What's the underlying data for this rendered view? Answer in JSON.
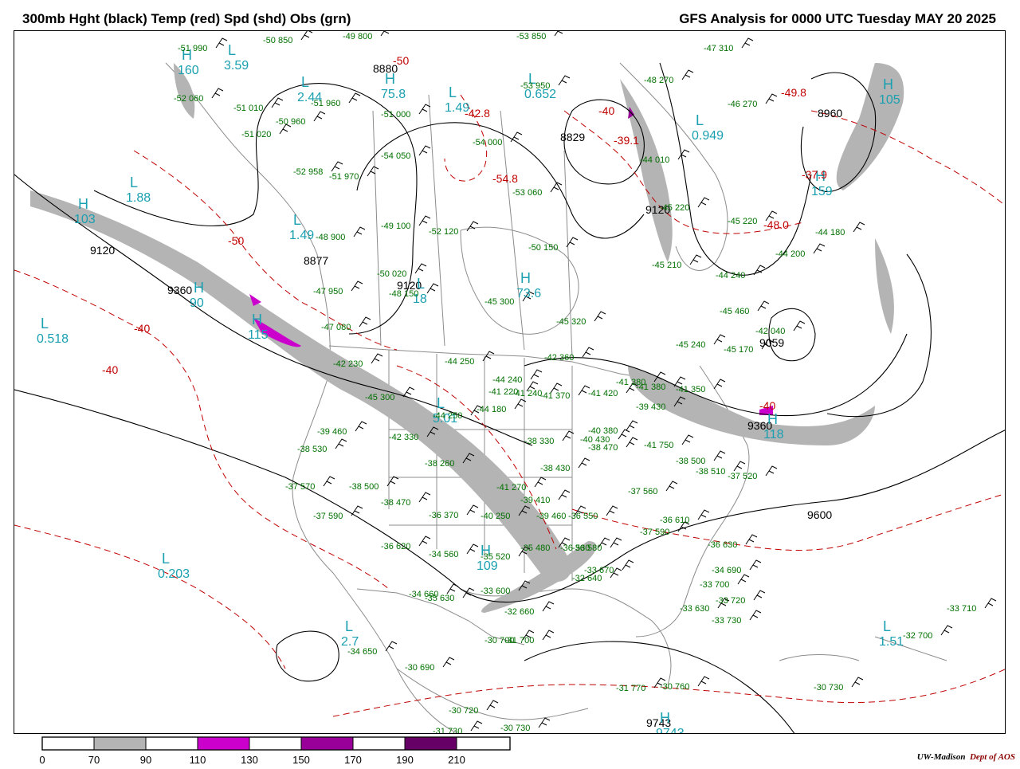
{
  "header": {
    "left_title": "300mb Hght (black) Temp (red) Spd (shd) Obs (grn)",
    "right_title": "GFS Analysis for 0000 UTC Tuesday  MAY 20 2025"
  },
  "colors": {
    "height_contour": "#000000",
    "temp_contour": "#c00000",
    "speed_shading_70_90": "#b4b4b4",
    "speed_shading_110_130": "#cc00cc",
    "speed_shading_150_170": "#990099",
    "speed_shading_190_210": "#660066",
    "obs_text": "#007000",
    "speed_label": "#1aa0b0",
    "geography": "#888888"
  },
  "legend": {
    "ticks": [
      "0",
      "70",
      "90",
      "110",
      "130",
      "150",
      "170",
      "190",
      "210"
    ]
  },
  "credit": {
    "org": "UW-Madison",
    "dept": "Dept of AOS"
  },
  "height_labels": [
    {
      "text": "9360"
    },
    {
      "text": "9120"
    },
    {
      "text": "9120"
    },
    {
      "text": "9120"
    },
    {
      "text": "8877"
    },
    {
      "text": "8880"
    },
    {
      "text": "8829"
    },
    {
      "text": "8960"
    },
    {
      "text": "9360"
    },
    {
      "text": "9600"
    },
    {
      "text": "9743"
    },
    {
      "text": "9059"
    }
  ],
  "highs_lows": [
    {
      "letter": "L",
      "value": "3.59"
    },
    {
      "letter": "H",
      "value": "160"
    },
    {
      "letter": "L",
      "value": "2.44"
    },
    {
      "letter": "H",
      "value": "75.8"
    },
    {
      "letter": "L",
      "value": "1.49"
    },
    {
      "letter": "L",
      "value": "0.652"
    },
    {
      "letter": "L",
      "value": "0.949"
    },
    {
      "letter": "H",
      "value": "105"
    },
    {
      "letter": "L",
      "value": "1.88"
    },
    {
      "letter": "H",
      "value": "103"
    },
    {
      "letter": "L",
      "value": "1.49"
    },
    {
      "letter": "L",
      "value": "18"
    },
    {
      "letter": "H",
      "value": "73.6"
    },
    {
      "letter": "L",
      "value": "0.518"
    },
    {
      "letter": "H",
      "value": "115"
    },
    {
      "letter": "L",
      "value": "5.01"
    },
    {
      "letter": "H",
      "value": "109"
    },
    {
      "letter": "L",
      "value": "0.203"
    },
    {
      "letter": "L",
      "value": "2.7"
    },
    {
      "letter": "L",
      "value": "1.51"
    },
    {
      "letter": "H",
      "value": "159"
    },
    {
      "letter": "H",
      "value": "118"
    },
    {
      "letter": "H",
      "value": "90"
    },
    {
      "letter": "H",
      "value": "9743"
    }
  ],
  "temp_labels": [
    "-50",
    "-42.8",
    "-40",
    "-39.1",
    "-49.8",
    "-54.8",
    "-37.9",
    "-48.0",
    "-40",
    "-40",
    "-50",
    "-40"
  ],
  "observations": [
    "-51 990",
    "-50 850",
    "-49 800",
    "-53 850",
    "-52 060",
    "-51 010",
    "-51 960",
    "-50 960",
    "-51 020",
    "-51 000",
    "-53 950",
    "-47 310",
    "-48 270",
    "-46 270",
    "-54 050",
    "-54 000",
    "-52 958",
    "-51 970",
    "-53 060",
    "-44 010",
    "-45 220",
    "-49 100",
    "-52 120",
    "-48 900",
    "-50 150",
    "-45 210",
    "-45 220",
    "-44 180",
    "-44 200",
    "-50 020",
    "-48 150",
    "-44 240",
    "-47 950",
    "-45 300",
    "-45 320",
    "-45 460",
    "-42 040",
    "-47 080",
    "-45 240",
    "-45 170",
    "-42 230",
    "-44 250",
    "-42 360",
    "-44 240",
    "-41 220",
    "-41 380",
    "-45 300",
    "-44 250",
    "-44 180",
    "-41 240",
    "-41 370",
    "-41 420",
    "-41 380",
    "-41 350",
    "-39 430",
    "-40 380",
    "-42 330",
    "-40 430",
    "-38 470",
    "-38 330",
    "-39 460",
    "-38 530",
    "-38 260",
    "-38 430",
    "-41 750",
    "-38 500",
    "-38 510",
    "-37 520",
    "-37 570",
    "-38 500",
    "-41 270",
    "-39 410",
    "-37 560",
    "-36 370",
    "-38 470",
    "-37 590",
    "-40 250",
    "-39 460",
    "-36 550",
    "-37 590",
    "-36 610",
    "-36 620",
    "-34 560",
    "-35 520",
    "-35 480",
    "-36 530",
    "-36 580",
    "-36 630",
    "-34 660",
    "-35 630",
    "-33 630",
    "-32 640",
    "-33 670",
    "-34 690",
    "-33 700",
    "-33 720",
    "-33 730",
    "-33 710",
    "-33 600",
    "-32 660",
    "-34 650",
    "-30 700",
    "-31 700",
    "-32 700",
    "-30 690",
    "-31 770",
    "-30 760",
    "-30 730",
    "-30 720",
    "-31 730",
    "-30 730"
  ]
}
